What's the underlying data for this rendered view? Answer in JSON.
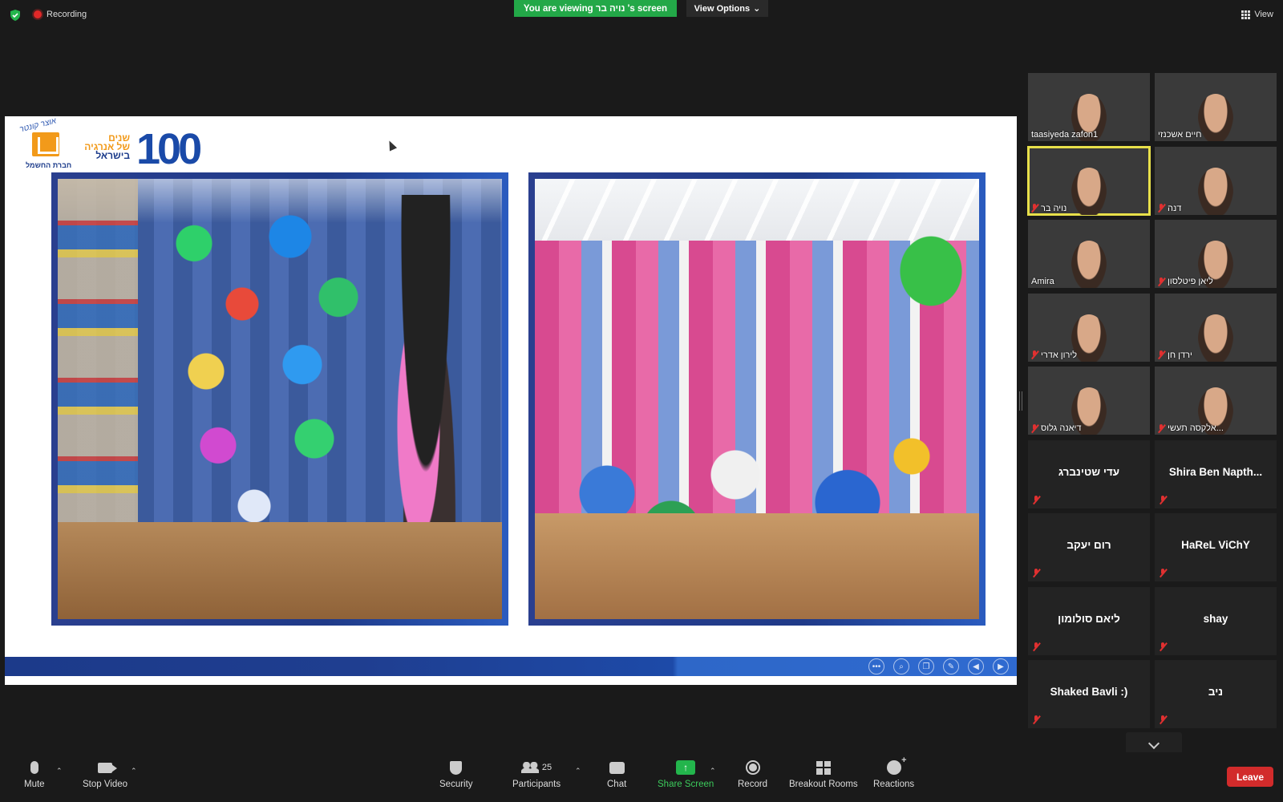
{
  "topbar": {
    "recording_label": "Recording",
    "viewing_banner": "You are viewing נויה בר 's screen",
    "view_options_label": "View Options",
    "view_label": "View"
  },
  "slide": {
    "logo_script": "אוצר קונטר",
    "logo_company": "חברת החשמל",
    "years_line1": "שנים",
    "years_line2": "של אנרגיה",
    "years_line3": "בישראל",
    "hundred": "100"
  },
  "participants": [
    {
      "name": "taasiyeda zafon1",
      "muted": false,
      "video": true
    },
    {
      "name": "חיים אשכנזי",
      "muted": false,
      "video": true
    },
    {
      "name": "נויה בר",
      "muted": true,
      "video": true,
      "active": true
    },
    {
      "name": "דנה",
      "muted": true,
      "video": true
    },
    {
      "name": "Amira",
      "muted": false,
      "video": true
    },
    {
      "name": "ליאן פיטלסון",
      "muted": true,
      "video": true
    },
    {
      "name": "לירון אדרי",
      "muted": true,
      "video": true
    },
    {
      "name": "ירדן חן",
      "muted": true,
      "video": true
    },
    {
      "name": "דיאנה גלוס",
      "muted": true,
      "video": true
    },
    {
      "name": "אלקסה תעשי...",
      "muted": true,
      "video": true
    },
    {
      "name": "עדי שטינברג",
      "muted": true,
      "video": false
    },
    {
      "name": "Shira Ben Napth...",
      "muted": true,
      "video": false
    },
    {
      "name": "רום יעקב",
      "muted": true,
      "video": false
    },
    {
      "name": "HaReL ViChY",
      "muted": true,
      "video": false
    },
    {
      "name": "ליאם סולומון",
      "muted": true,
      "video": false
    },
    {
      "name": "shay",
      "muted": true,
      "video": false
    },
    {
      "name": "Shaked Bavli :)",
      "muted": true,
      "video": false
    },
    {
      "name": "ניב",
      "muted": true,
      "video": false
    }
  ],
  "toolbar": {
    "mute": "Mute",
    "stop_video": "Stop Video",
    "security": "Security",
    "participants": "Participants",
    "participants_count": "25",
    "chat": "Chat",
    "share_screen": "Share Screen",
    "record": "Record",
    "breakout_rooms": "Breakout Rooms",
    "reactions": "Reactions",
    "leave": "Leave"
  },
  "colors": {
    "viewing_green": "#23a848",
    "leave_red": "#d22b2b",
    "active_speaker": "#e8e04a",
    "slide_blue": "#1f3a88"
  }
}
